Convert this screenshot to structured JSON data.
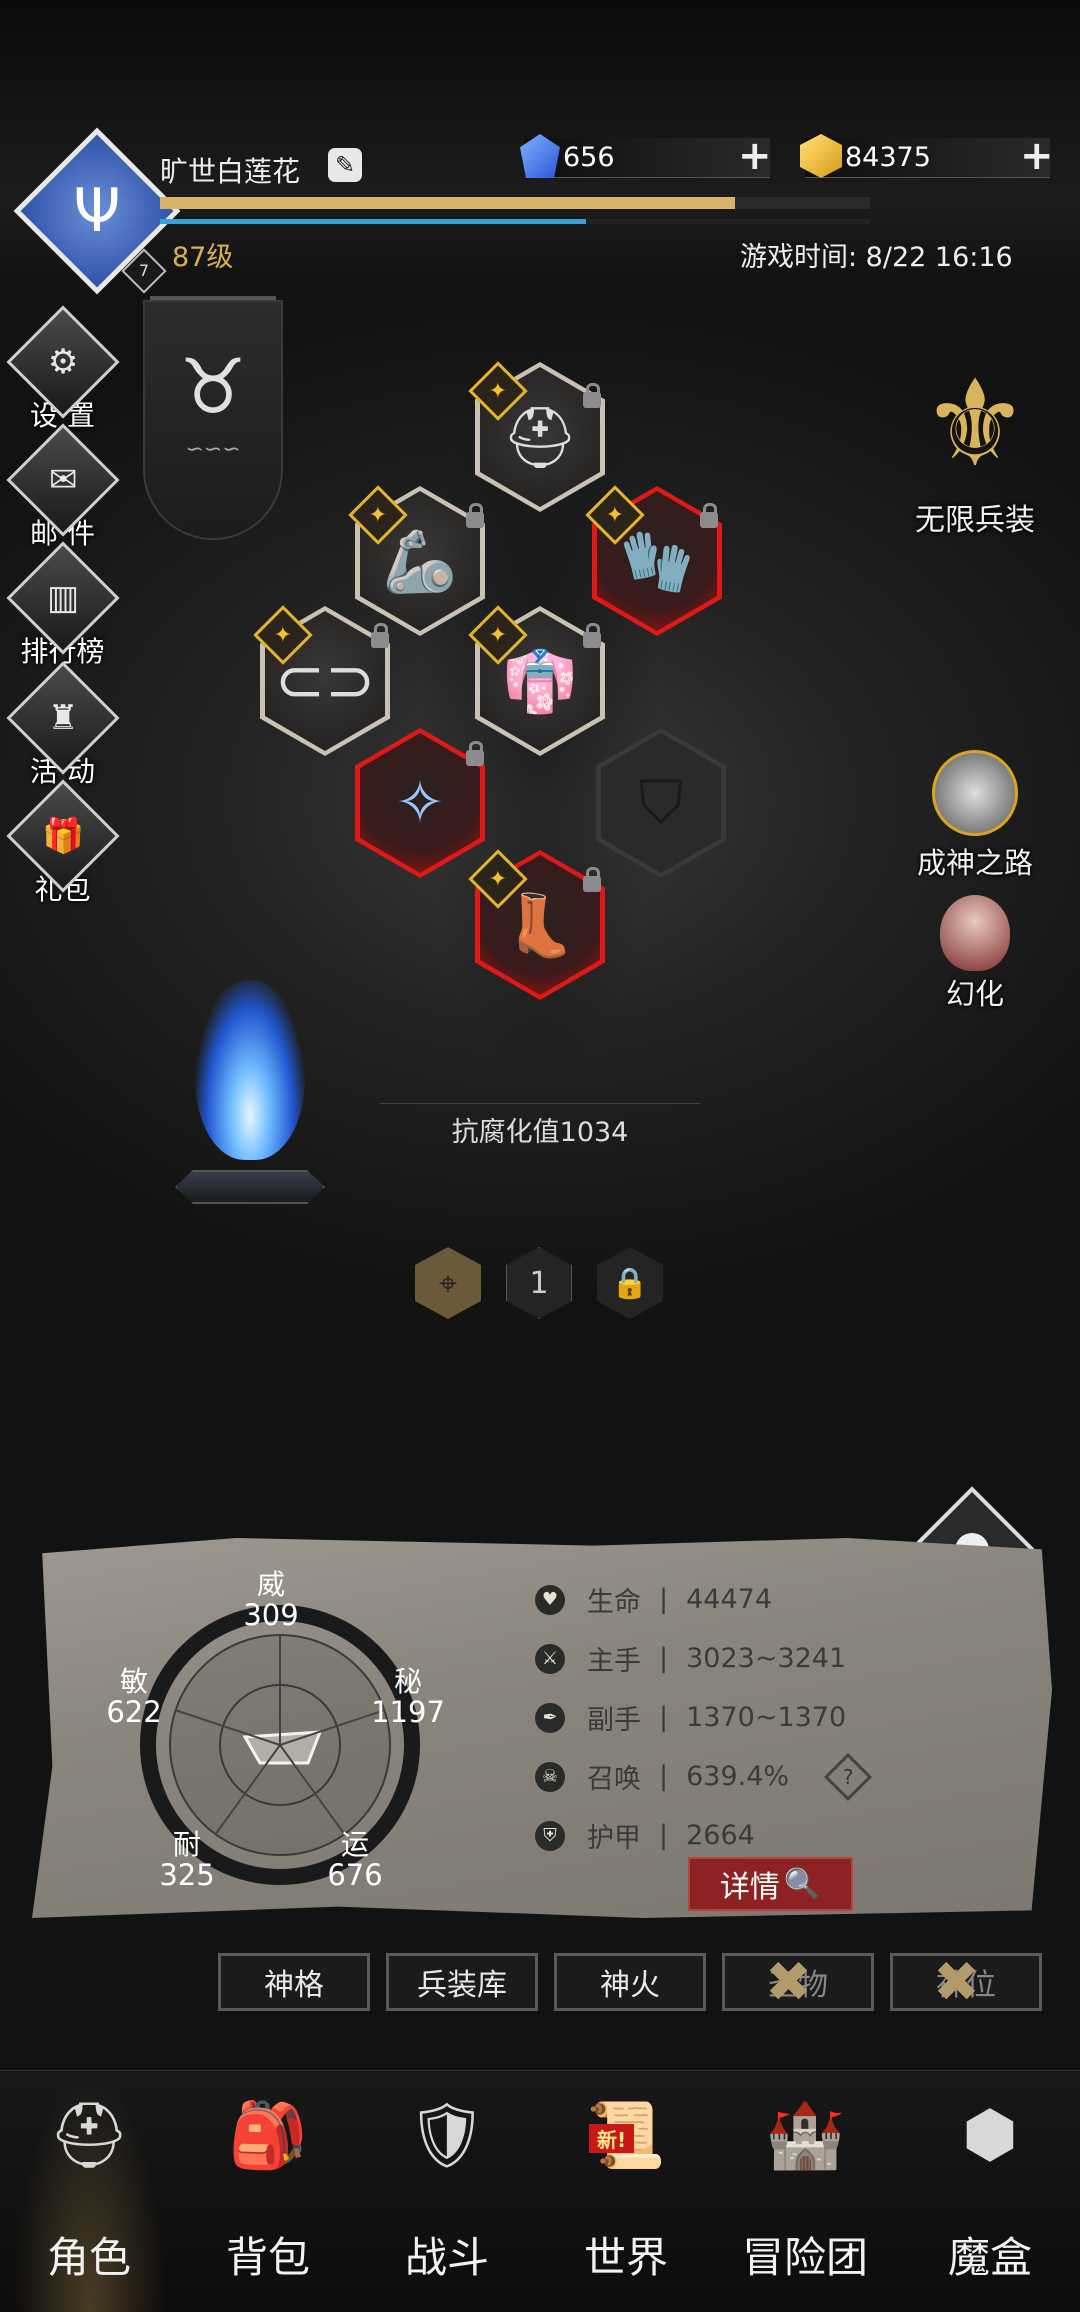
{
  "player": {
    "name": "旷世白莲花",
    "level": "87级",
    "rank_badge": "7",
    "exp_fraction": 0.81,
    "mp_fraction": 0.6
  },
  "currency": {
    "gems": "656",
    "gold": "84375"
  },
  "game_time": "游戏时间: 8/22 16:16",
  "side_menu": [
    {
      "label": "设 置",
      "icon": "gear-icon"
    },
    {
      "label": "邮 件",
      "icon": "mail-icon"
    },
    {
      "label": "排行榜",
      "icon": "ranking-icon"
    },
    {
      "label": "活 动",
      "icon": "event-icon"
    },
    {
      "label": "礼包",
      "icon": "gift-icon"
    }
  ],
  "right_menu": {
    "infinite": "无限兵装",
    "godpath": "成神之路",
    "transform": "幻化"
  },
  "equipment": {
    "corruption": "抗腐化值1034",
    "page_number": "1"
  },
  "stats": {
    "pentagon": {
      "wei_label": "威",
      "wei": "309",
      "mi_label": "秘",
      "mi": "1197",
      "yun_label": "运",
      "yun": "676",
      "nai_label": "耐",
      "nai": "325",
      "min_label": "敏",
      "min": "622"
    },
    "hp_label": "生命",
    "hp": "44474",
    "main_label": "主手",
    "main": "3023~3241",
    "off_label": "副手",
    "off": "1370~1370",
    "summon_label": "召唤",
    "summon": "639.4%",
    "armor_label": "护甲",
    "armor": "2664",
    "detail_button": "详情"
  },
  "tabs": [
    "神格",
    "兵装库",
    "神火",
    "圣物",
    "神位"
  ],
  "bottom_nav": [
    {
      "label": "角色"
    },
    {
      "label": "背包"
    },
    {
      "label": "战斗"
    },
    {
      "label": "世界",
      "badge": "新!"
    },
    {
      "label": "冒险团"
    },
    {
      "label": "魔盒"
    }
  ],
  "colors": {
    "accent_gold": "#e3b430",
    "rare_red": "#e01818",
    "exp_bar": "#d9b36b",
    "mp_bar": "#3aa0d8"
  }
}
